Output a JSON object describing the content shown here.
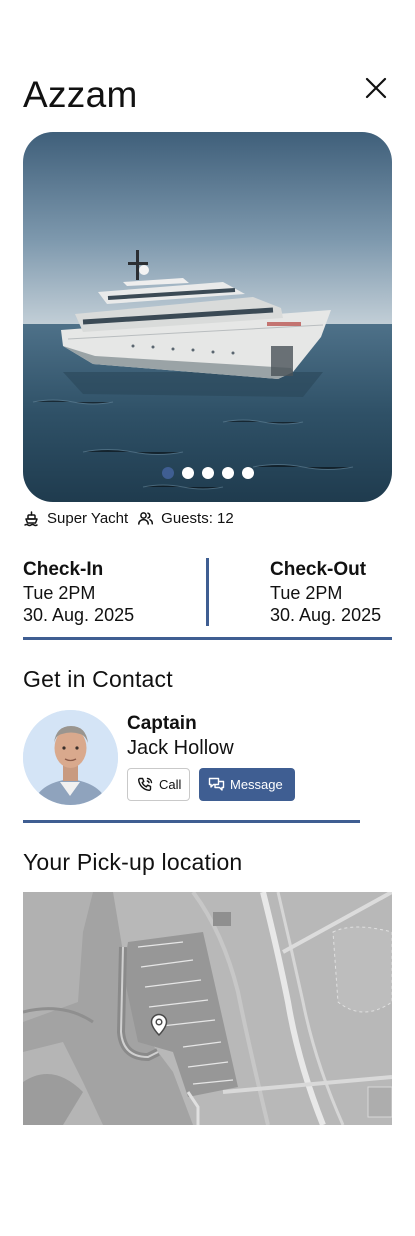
{
  "header": {
    "title": "Azzam"
  },
  "gallery": {
    "slide_count": 5,
    "active_index": 0
  },
  "meta": {
    "vessel_type": "Super Yacht",
    "guests": "Guests: 12"
  },
  "stay": {
    "check_in": {
      "heading": "Check-In",
      "time": "Tue 2PM",
      "date": "30. Aug. 2025"
    },
    "check_out": {
      "heading": "Check-Out",
      "time": "Tue 2PM",
      "date": "30. Aug. 2025"
    }
  },
  "contact": {
    "section_title": "Get in Contact",
    "role": "Captain",
    "name": "Jack Hollow",
    "call_label": "Call",
    "message_label": "Message"
  },
  "pickup": {
    "section_title": "Your Pick-up location"
  },
  "colors": {
    "accent": "#3f5e92",
    "text": "#111111",
    "map_base": "#a3a3a3"
  },
  "icons": {
    "close": "close-icon",
    "vessel": "ship-icon",
    "guests": "users-icon",
    "call": "phone-call-icon",
    "message": "chat-bubbles-icon",
    "map_pin": "map-pin-icon"
  }
}
